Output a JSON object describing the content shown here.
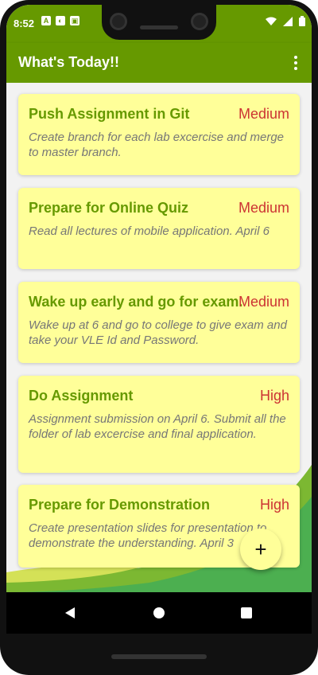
{
  "statusbar": {
    "time": "8:52",
    "notification_icons": [
      "A",
      "◐",
      "▣"
    ]
  },
  "app": {
    "title": "What's Today!!",
    "colors": {
      "primary": "#669900",
      "card": "#ffff99",
      "priority": "#cc3333"
    }
  },
  "tasks": [
    {
      "title": "Push Assignment in Git",
      "priority": "Medium",
      "description": "Create branch for each lab excercise and merge to master branch."
    },
    {
      "title": "Prepare for Online Quiz",
      "priority": "Medium",
      "description": "Read all lectures of mobile application. April 6"
    },
    {
      "title": "Wake up early and go for exam.",
      "priority": "Medium",
      "description": "Wake up at 6 and go to college to give exam and take your VLE Id and Password."
    },
    {
      "title": "Do Assignment",
      "priority": "High",
      "description": "Assignment submission on April 6. Submit all the folder of lab excercise and final application."
    },
    {
      "title": "Prepare for Demonstration",
      "priority": "High",
      "description": "Create presentation slides for presentation to demonstrate the understanding. April 3"
    }
  ],
  "fab": {
    "label": "+"
  }
}
